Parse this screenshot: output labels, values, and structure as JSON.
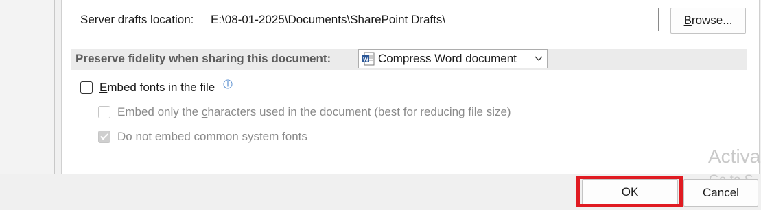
{
  "server_drafts": {
    "label_before": "Ser",
    "label_accel": "v",
    "label_after": "er drafts location:",
    "value": "E:\\08-01-2025\\Documents\\SharePoint Drafts\\",
    "browse_accel": "B",
    "browse_rest": "rowse..."
  },
  "fidelity": {
    "title_before": "Preserve fi",
    "title_accel": "d",
    "title_after": "elity when sharing this document:",
    "selected_document": "Compress Word document",
    "doc_icon": "word-document-icon",
    "arrow_icon": "chevron-down-icon"
  },
  "embed": {
    "fonts_accel": "E",
    "fonts_rest": "mbed fonts in the file",
    "fonts_checked": false,
    "info_icon": "info-icon",
    "only_chars_before": "Embed only the ",
    "only_chars_accel": "c",
    "only_chars_after": "haracters used in the document (best for reducing file size)",
    "only_chars_checked": false,
    "no_common_before": "Do ",
    "no_common_accel": "n",
    "no_common_after": "ot embed common system fonts",
    "no_common_checked": true
  },
  "footer": {
    "ok_label": "OK",
    "cancel_label": "Cancel",
    "highlight_color": "#e01b22"
  },
  "watermark": {
    "line1": "Activa",
    "line2": "Go to S"
  }
}
